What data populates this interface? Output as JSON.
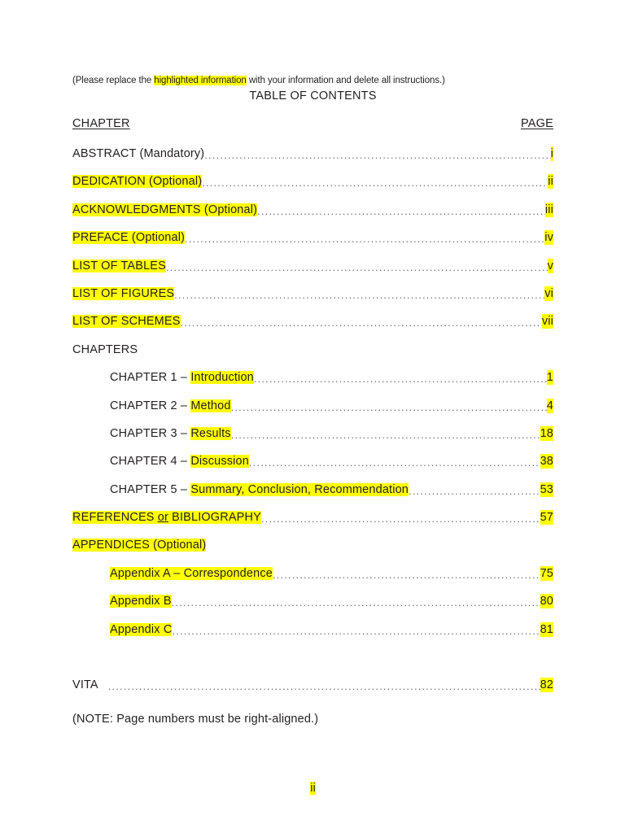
{
  "document": {
    "instruction_pre": "(Please replace the ",
    "instruction_highlight": "highlighted information",
    "instruction_post": " with your information and delete all instructions.)",
    "title": "TABLE OF CONTENTS",
    "footer_page_number": "ii",
    "note": "(NOTE:  Page numbers must be right-aligned.)"
  },
  "columns": {
    "chapter_header": "CHAPTER",
    "page_header": "PAGE"
  },
  "colors": {
    "highlight": "#FFFF00",
    "text": "#231f20",
    "leader": "#6d6d6d",
    "page_background": "#FFFFFF"
  },
  "entries": [
    {
      "label": "ABSTRACT (Mandatory)",
      "label_highlighted": false,
      "page": "i",
      "page_highlighted": true,
      "indent": false,
      "leader": true
    },
    {
      "label": "DEDICATION (Optional)",
      "label_highlighted": true,
      "page": "ii",
      "page_highlighted": true,
      "indent": false,
      "leader": true
    },
    {
      "label": "ACKNOWLEDGMENTS (Optional)",
      "label_highlighted": true,
      "page": "iii",
      "page_highlighted": true,
      "indent": false,
      "leader": true
    },
    {
      "label": "PREFACE (Optional)",
      "label_highlighted": true,
      "page": "iv",
      "page_highlighted": true,
      "indent": false,
      "leader": true
    },
    {
      "label": "LIST OF TABLES",
      "label_highlighted": true,
      "page": "v",
      "page_highlighted": true,
      "indent": false,
      "leader": true
    },
    {
      "label": "LIST OF FIGURES",
      "label_highlighted": true,
      "page": "vi",
      "page_highlighted": true,
      "indent": false,
      "leader": true
    },
    {
      "label": "LIST OF SCHEMES",
      "label_highlighted": true,
      "page": "vii",
      "page_highlighted": true,
      "indent": false,
      "leader": true
    },
    {
      "label": "CHAPTERS",
      "label_highlighted": false,
      "page": "",
      "page_highlighted": false,
      "indent": false,
      "leader": false
    },
    {
      "prefix": "CHAPTER 1 – ",
      "label": "Introduction",
      "label_highlighted": true,
      "page": "1",
      "page_highlighted": true,
      "indent": true,
      "leader": true
    },
    {
      "prefix": "CHAPTER 2 – ",
      "label": "Method",
      "label_highlighted": true,
      "page": "4",
      "page_highlighted": true,
      "indent": true,
      "leader": true
    },
    {
      "prefix": "CHAPTER 3 – ",
      "label": "Results",
      "label_highlighted": true,
      "page": "18",
      "page_highlighted": true,
      "indent": true,
      "leader": true
    },
    {
      "prefix": "CHAPTER 4 – ",
      "label": "Discussion",
      "label_highlighted": true,
      "page": "38",
      "page_highlighted": true,
      "indent": true,
      "leader": true
    },
    {
      "prefix": "CHAPTER 5 – ",
      "label": "Summary, Conclusion, Recommendation",
      "label_highlighted": true,
      "page": "53",
      "page_highlighted": true,
      "indent": true,
      "leader": true
    },
    {
      "label": "REFERENCES or BIBLIOGRAPHY",
      "label_parts": [
        "REFERENCES ",
        "or",
        " BIBLIOGRAPHY"
      ],
      "label_highlighted": true,
      "underline_part": "or",
      "page": "57",
      "page_highlighted": true,
      "indent": false,
      "leader": true
    },
    {
      "label": "APPENDICES (Optional)",
      "label_highlighted": true,
      "page": "",
      "page_highlighted": false,
      "indent": false,
      "leader": false
    },
    {
      "label": "Appendix A – Correspondence",
      "label_highlighted": true,
      "page": "75",
      "page_highlighted": true,
      "indent": true,
      "leader": true
    },
    {
      "label": "Appendix B ",
      "label_highlighted": true,
      "page": "80",
      "page_highlighted": true,
      "indent": true,
      "leader": true
    },
    {
      "label": "Appendix C ",
      "label_highlighted": true,
      "page": "81",
      "page_highlighted": true,
      "indent": true,
      "leader": true
    }
  ],
  "vita": {
    "label": "VITA",
    "label_highlighted": false,
    "page": "82",
    "page_highlighted": true
  }
}
